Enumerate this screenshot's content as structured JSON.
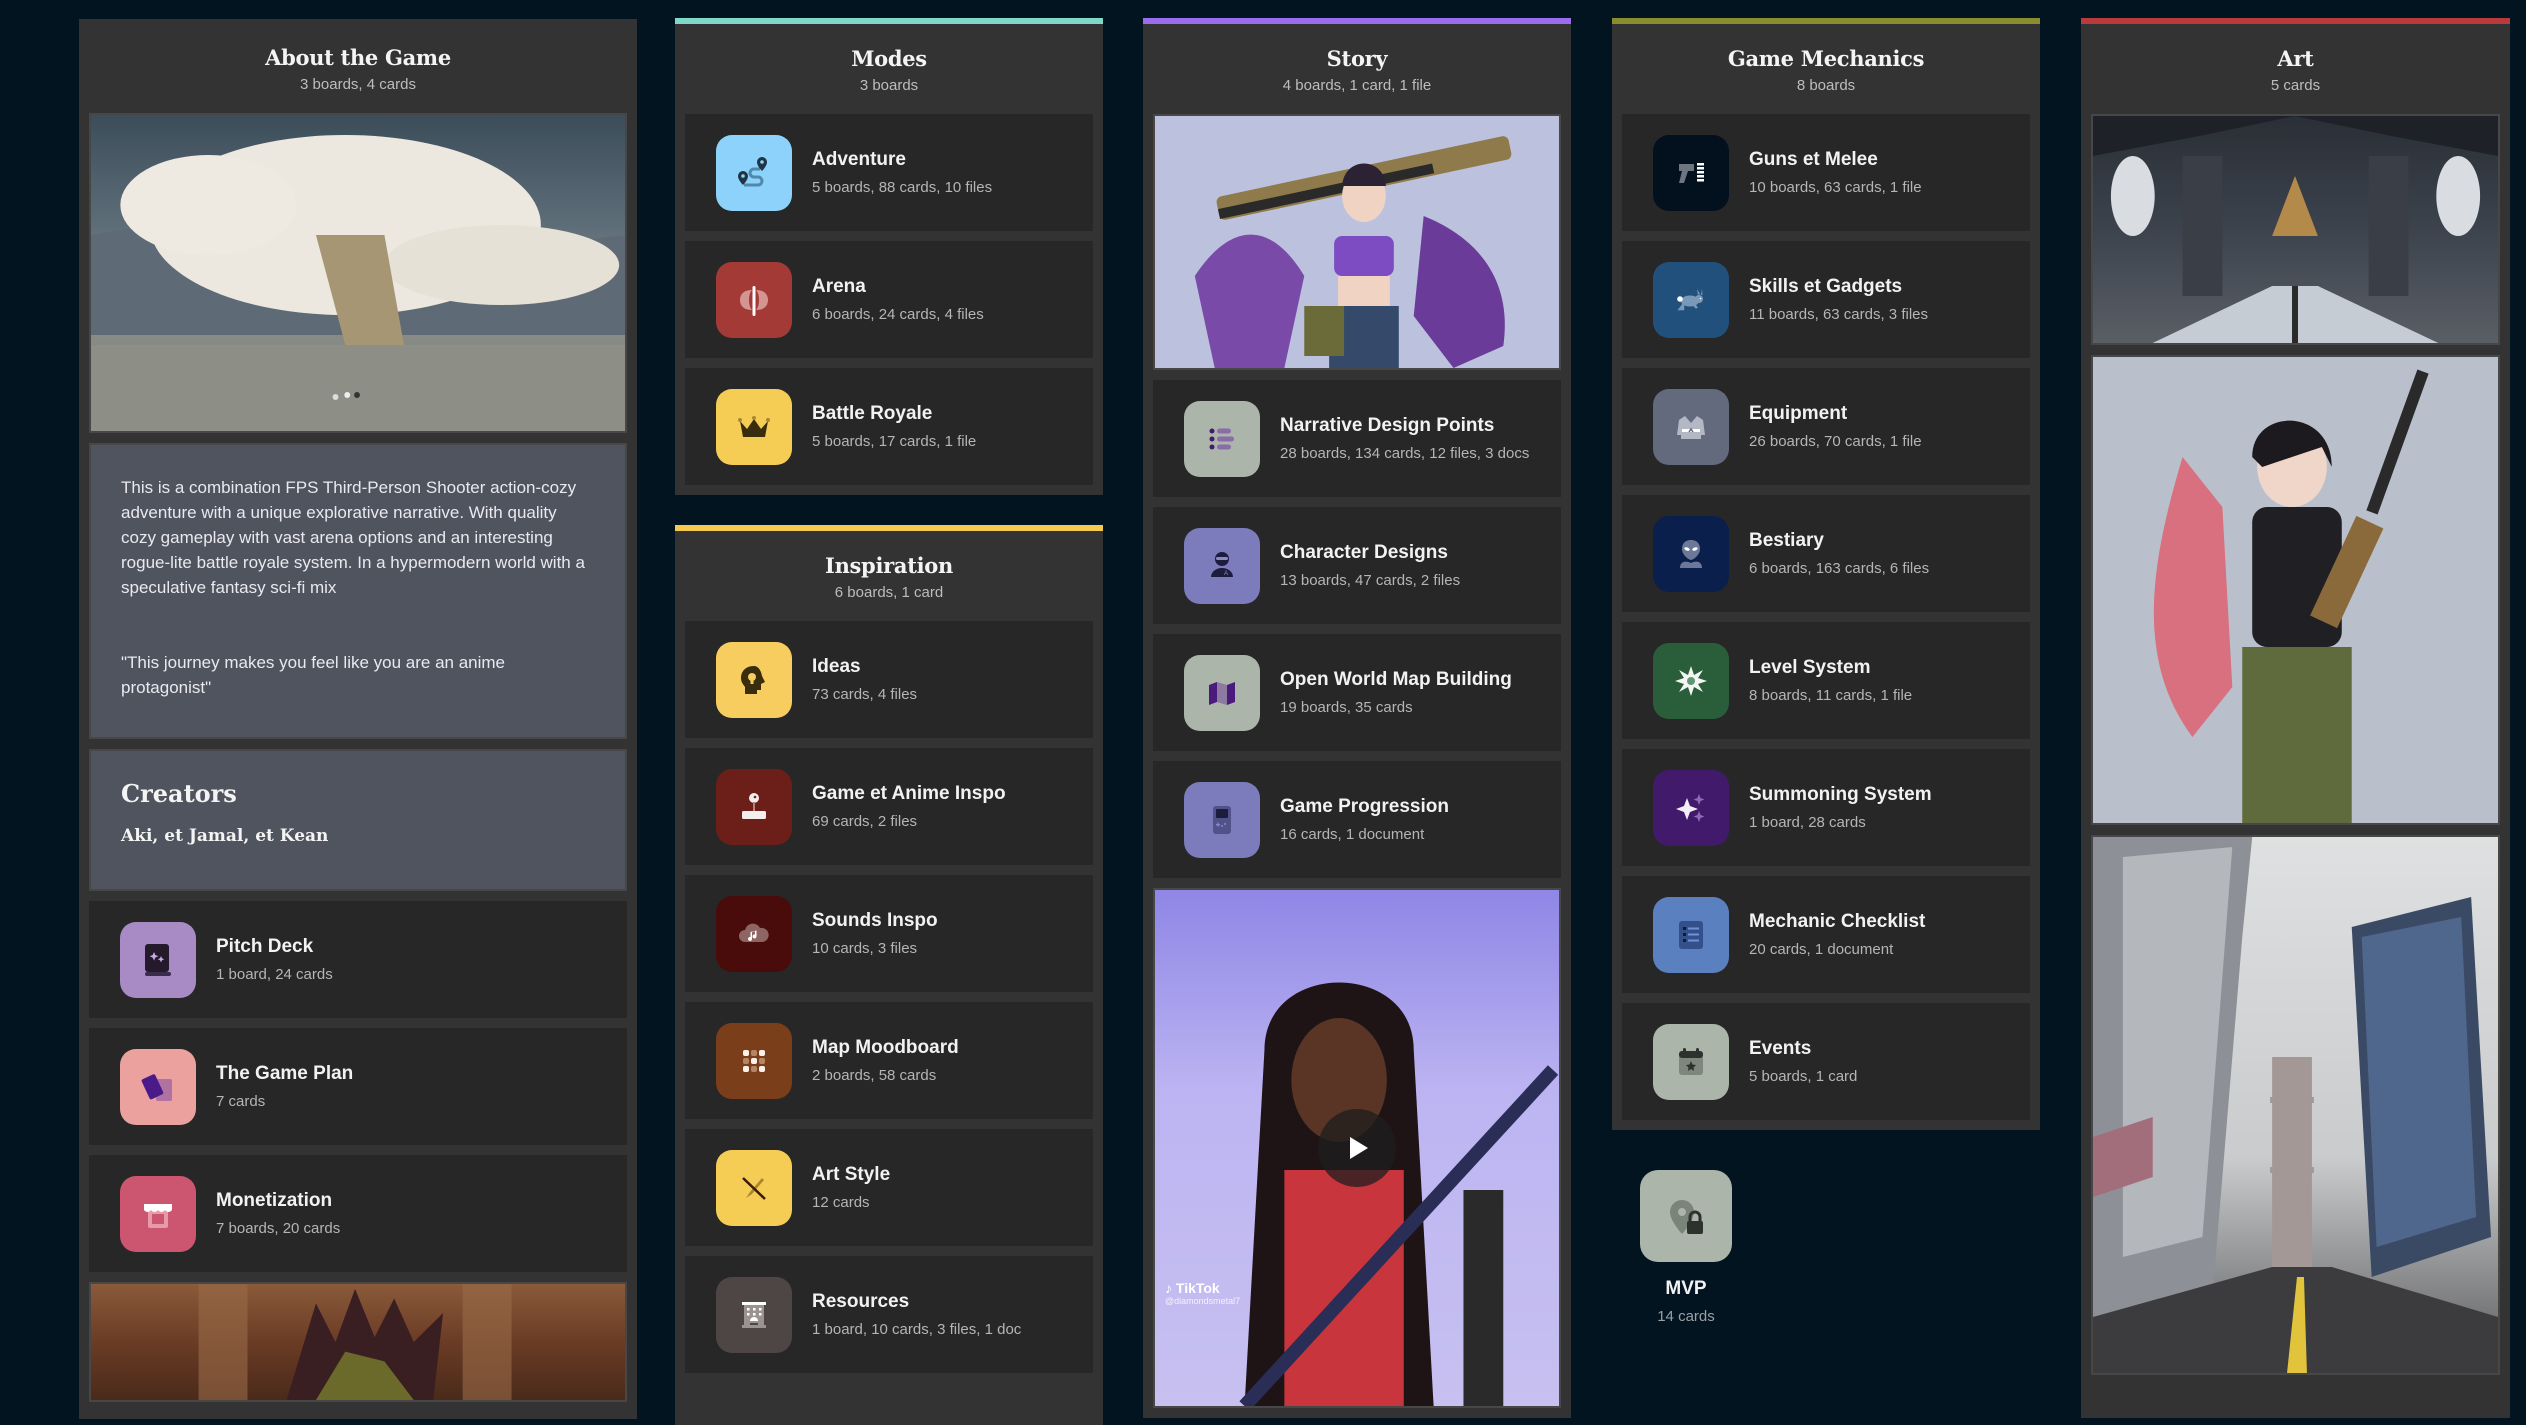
{
  "columns": {
    "about": {
      "title": "About the Game",
      "subtitle": "3 boards, 4 cards",
      "description": "This is a combination FPS Third-Person Shooter action-cozy adventure with a unique explorative narrative. With quality cozy gameplay with vast arena options and an interesting rogue-lite battle royale system. In a hypermodern world with a speculative fantasy sci-fi mix",
      "quote": "\"This journey makes you feel like you are an anime protagonist\"",
      "creators_heading": "Creators",
      "creators_names": "Aki, et Jamal, et Kean",
      "boards": [
        {
          "title": "Pitch Deck",
          "sub": "1 board, 24 cards",
          "icon": "book-sparkle-icon",
          "color": "#a88bc4"
        },
        {
          "title": "The Game Plan",
          "sub": "7 cards",
          "icon": "cards-icon",
          "color": "#eba19d"
        },
        {
          "title": "Monetization",
          "sub": "7 boards, 20 cards",
          "icon": "storefront-icon",
          "color": "#cc566f"
        }
      ]
    },
    "modes": {
      "title": "Modes",
      "subtitle": "3 boards",
      "accent": "#7fd9c8",
      "boards": [
        {
          "title": "Adventure",
          "sub": "5 boards, 88 cards, 10 files",
          "icon": "route-pins-icon",
          "color": "#8dd2fb"
        },
        {
          "title": "Arena",
          "sub": "6 boards, 24 cards, 4 files",
          "icon": "battle-axe-icon",
          "color": "#a33a36"
        },
        {
          "title": "Battle Royale",
          "sub": "5 boards, 17 cards, 1 file",
          "icon": "crown-icon",
          "color": "#f6cd54"
        }
      ]
    },
    "inspiration": {
      "title": "Inspiration",
      "subtitle": "6 boards, 1 card",
      "accent": "#f4cb4e",
      "boards": [
        {
          "title": "Ideas",
          "sub": "73 cards, 4 files",
          "icon": "head-lightbulb-icon",
          "color": "#f6cd5e"
        },
        {
          "title": "Game et Anime Inspo",
          "sub": "69 cards, 2 files",
          "icon": "joystick-icon",
          "color": "#6c1f18"
        },
        {
          "title": "Sounds Inspo",
          "sub": "10 cards, 3 files",
          "icon": "cloud-music-icon",
          "color": "#4a0c0a"
        },
        {
          "title": "Map Moodboard",
          "sub": "2 boards, 58 cards",
          "icon": "grid-dots-icon",
          "color": "#7a3f1a"
        },
        {
          "title": "Art Style",
          "sub": "12 cards",
          "icon": "pen-nib-slash-icon",
          "color": "#f6cd54"
        },
        {
          "title": "Resources",
          "sub": "1 board, 10 cards, 3 files, 1 doc",
          "icon": "building-icon",
          "color": "#4e4645"
        }
      ]
    },
    "story": {
      "title": "Story",
      "subtitle": "4 boards, 1 card, 1 file",
      "accent": "#9b6cf0",
      "boards": [
        {
          "title": "Narrative Design Points",
          "sub": "28 boards, 134 cards, 12 files, 3 docs",
          "icon": "list-bullets-icon",
          "color": "#abb5a9"
        },
        {
          "title": "Character Designs",
          "sub": "13 boards, 47 cards, 2 files",
          "icon": "person-visor-icon",
          "color": "#7c7cbd"
        },
        {
          "title": "Open World Map Building",
          "sub": "19 boards, 35 cards",
          "icon": "folded-map-icon",
          "color": "#abb5a9"
        },
        {
          "title": "Game Progression",
          "sub": "16 cards, 1 document",
          "icon": "handheld-console-icon",
          "color": "#7c7cbd"
        }
      ],
      "video": {
        "brand": "TikTok",
        "handle": "@diamondsmetal7"
      }
    },
    "mechanics": {
      "title": "Game Mechanics",
      "subtitle": "8 boards",
      "accent": "#8a8d2e",
      "boards": [
        {
          "title": "Guns et Melee",
          "sub": "10 boards, 63 cards, 1 file",
          "icon": "gun-ammo-icon",
          "color": "#03111f"
        },
        {
          "title": "Skills et Gadgets",
          "sub": "11 boards, 63 cards, 3 files",
          "icon": "rabbit-running-icon",
          "color": "#22507d"
        },
        {
          "title": "Equipment",
          "sub": "26 boards, 70 cards, 1 file",
          "icon": "jacket-icon",
          "color": "#636a7e"
        },
        {
          "title": "Bestiary",
          "sub": "6 boards, 163 cards, 6 files",
          "icon": "alien-icon",
          "color": "#0b1f4d"
        },
        {
          "title": "Level System",
          "sub": "8 boards, 11 cards, 1 file",
          "icon": "starburst-icon",
          "color": "#2a5e3a"
        },
        {
          "title": "Summoning System",
          "sub": "1 board, 28 cards",
          "icon": "sparkles-icon",
          "color": "#421a6b"
        },
        {
          "title": "Mechanic Checklist",
          "sub": "20 cards, 1 document",
          "icon": "checklist-icon",
          "color": "#5b80bf"
        },
        {
          "title": "Events",
          "sub": "5 boards, 1 card",
          "icon": "calendar-star-icon",
          "color": "#abb5a9"
        }
      ]
    },
    "art": {
      "title": "Art",
      "subtitle": "5 cards",
      "accent": "#b83a3a"
    }
  },
  "mvp": {
    "title": "MVP",
    "sub": "14 cards",
    "icon": "pin-lock-icon",
    "color": "#abb5a9"
  }
}
